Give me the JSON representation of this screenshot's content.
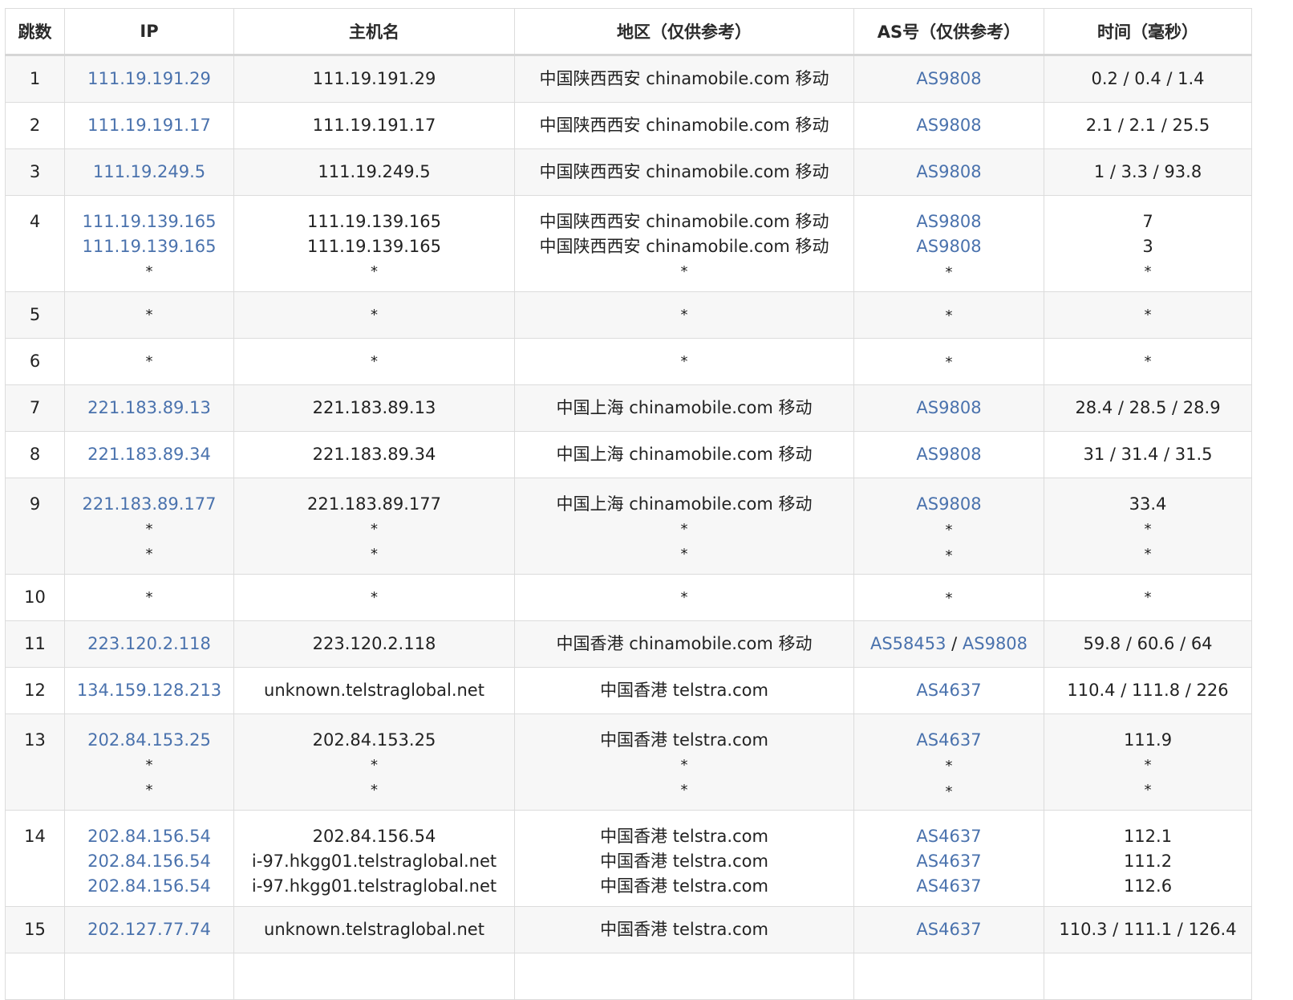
{
  "headers": [
    "跳数",
    "IP",
    "主机名",
    "地区（仅供参考）",
    "AS号（仅供参考）",
    "时间（毫秒）"
  ],
  "rows": [
    {
      "hop": "1",
      "ips": [
        "111.19.191.29"
      ],
      "hosts": [
        "111.19.191.29"
      ],
      "regions": [
        "中国陕西西安 chinamobile.com 移动"
      ],
      "asns": [
        [
          "AS9808"
        ]
      ],
      "times": [
        "0.2 / 0.4 / 1.4"
      ]
    },
    {
      "hop": "2",
      "ips": [
        "111.19.191.17"
      ],
      "hosts": [
        "111.19.191.17"
      ],
      "regions": [
        "中国陕西西安 chinamobile.com 移动"
      ],
      "asns": [
        [
          "AS9808"
        ]
      ],
      "times": [
        "2.1 / 2.1 / 25.5"
      ]
    },
    {
      "hop": "3",
      "ips": [
        "111.19.249.5"
      ],
      "hosts": [
        "111.19.249.5"
      ],
      "regions": [
        "中国陕西西安 chinamobile.com 移动"
      ],
      "asns": [
        [
          "AS9808"
        ]
      ],
      "times": [
        "1 / 3.3 / 93.8"
      ]
    },
    {
      "hop": "4",
      "ips": [
        "111.19.139.165",
        "111.19.139.165",
        "*"
      ],
      "hosts": [
        "111.19.139.165",
        "111.19.139.165",
        "*"
      ],
      "regions": [
        "中国陕西西安 chinamobile.com 移动",
        "中国陕西西安 chinamobile.com 移动",
        "*"
      ],
      "asns": [
        [
          "AS9808"
        ],
        [
          "AS9808"
        ],
        [
          "*"
        ]
      ],
      "times": [
        "7",
        "3",
        "*"
      ]
    },
    {
      "hop": "5",
      "ips": [
        "*"
      ],
      "hosts": [
        "*"
      ],
      "regions": [
        "*"
      ],
      "asns": [
        [
          "*"
        ]
      ],
      "times": [
        "*"
      ]
    },
    {
      "hop": "6",
      "ips": [
        "*"
      ],
      "hosts": [
        "*"
      ],
      "regions": [
        "*"
      ],
      "asns": [
        [
          "*"
        ]
      ],
      "times": [
        "*"
      ]
    },
    {
      "hop": "7",
      "ips": [
        "221.183.89.13"
      ],
      "hosts": [
        "221.183.89.13"
      ],
      "regions": [
        "中国上海 chinamobile.com 移动"
      ],
      "asns": [
        [
          "AS9808"
        ]
      ],
      "times": [
        "28.4 / 28.5 / 28.9"
      ]
    },
    {
      "hop": "8",
      "ips": [
        "221.183.89.34"
      ],
      "hosts": [
        "221.183.89.34"
      ],
      "regions": [
        "中国上海 chinamobile.com 移动"
      ],
      "asns": [
        [
          "AS9808"
        ]
      ],
      "times": [
        "31 / 31.4 / 31.5"
      ]
    },
    {
      "hop": "9",
      "ips": [
        "221.183.89.177",
        "*",
        "*"
      ],
      "hosts": [
        "221.183.89.177",
        "*",
        "*"
      ],
      "regions": [
        "中国上海 chinamobile.com 移动",
        "*",
        "*"
      ],
      "asns": [
        [
          "AS9808"
        ],
        [
          "*"
        ],
        [
          "*"
        ]
      ],
      "times": [
        "33.4",
        "*",
        "*"
      ]
    },
    {
      "hop": "10",
      "ips": [
        "*"
      ],
      "hosts": [
        "*"
      ],
      "regions": [
        "*"
      ],
      "asns": [
        [
          "*"
        ]
      ],
      "times": [
        "*"
      ]
    },
    {
      "hop": "11",
      "ips": [
        "223.120.2.118"
      ],
      "hosts": [
        "223.120.2.118"
      ],
      "regions": [
        "中国香港 chinamobile.com 移动"
      ],
      "asns": [
        [
          "AS58453",
          "AS9808"
        ]
      ],
      "times": [
        "59.8 / 60.6 / 64"
      ]
    },
    {
      "hop": "12",
      "ips": [
        "134.159.128.213"
      ],
      "hosts": [
        "unknown.telstraglobal.net"
      ],
      "regions": [
        "中国香港 telstra.com"
      ],
      "asns": [
        [
          "AS4637"
        ]
      ],
      "times": [
        "110.4 / 111.8 / 226"
      ]
    },
    {
      "hop": "13",
      "ips": [
        "202.84.153.25",
        "*",
        "*"
      ],
      "hosts": [
        "202.84.153.25",
        "*",
        "*"
      ],
      "regions": [
        "中国香港 telstra.com",
        "*",
        "*"
      ],
      "asns": [
        [
          "AS4637"
        ],
        [
          "*"
        ],
        [
          "*"
        ]
      ],
      "times": [
        "111.9",
        "*",
        "*"
      ]
    },
    {
      "hop": "14",
      "ips": [
        "202.84.156.54",
        "202.84.156.54",
        "202.84.156.54"
      ],
      "hosts": [
        "202.84.156.54",
        "i-97.hkgg01.telstraglobal.net",
        "i-97.hkgg01.telstraglobal.net"
      ],
      "regions": [
        "中国香港 telstra.com",
        "中国香港 telstra.com",
        "中国香港 telstra.com"
      ],
      "asns": [
        [
          "AS4637"
        ],
        [
          "AS4637"
        ],
        [
          "AS4637"
        ]
      ],
      "times": [
        "112.1",
        "111.2",
        "112.6"
      ]
    },
    {
      "hop": "15",
      "ips": [
        "202.127.77.74"
      ],
      "hosts": [
        "unknown.telstraglobal.net"
      ],
      "regions": [
        "中国香港 telstra.com"
      ],
      "asns": [
        [
          "AS4637"
        ]
      ],
      "times": [
        "110.3 / 111.1 / 126.4"
      ]
    },
    {
      "hop": "",
      "ips": [
        ""
      ],
      "hosts": [
        ""
      ],
      "regions": [
        ""
      ],
      "asns": [
        [
          ""
        ]
      ],
      "times": [
        ""
      ]
    }
  ],
  "asn_separator": " / ",
  "colors": {
    "link": "#4a72ad",
    "row_alt": "#f7f7f7",
    "border": "#dcdcdc"
  }
}
